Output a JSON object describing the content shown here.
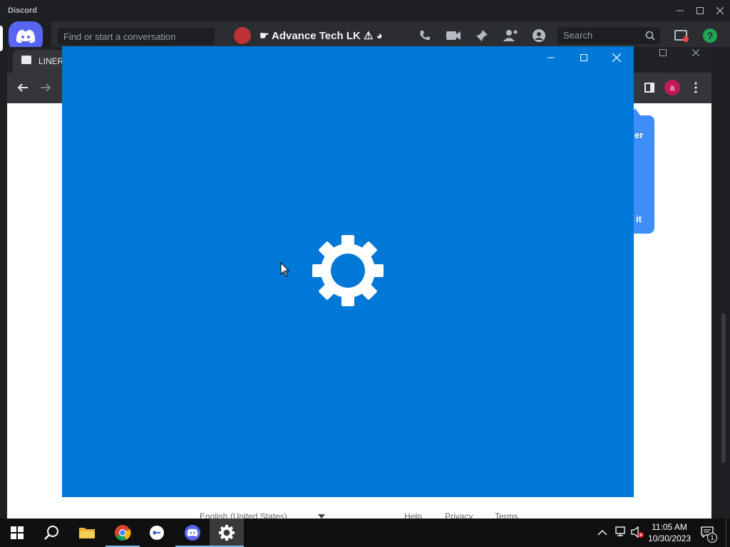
{
  "discord": {
    "app_title": "Discord",
    "find_placeholder": "Find or start a conversation",
    "channel_name": "☛ Advance Tech LK ⚠ ◕",
    "search_placeholder": "Search",
    "brand_color": "#5865f2"
  },
  "chrome": {
    "tab_title": "LINER",
    "profile_initial": "a",
    "popup_text_top": "er",
    "popup_text_bottom": "it",
    "footer": {
      "language": "English (United States)",
      "help": "Help",
      "privacy": "Privacy",
      "terms": "Terms"
    }
  },
  "settings_splash": {
    "background_color": "#0078d7",
    "icon": "gear-icon"
  },
  "taskbar": {
    "apps": [
      "start-icon",
      "search-icon",
      "file-explorer-icon",
      "chrome-icon",
      "app-icon",
      "discord-icon",
      "settings-icon"
    ],
    "active_app": "settings-icon",
    "time": "11:05 AM",
    "date": "10/30/2023",
    "notification_count": "1"
  }
}
